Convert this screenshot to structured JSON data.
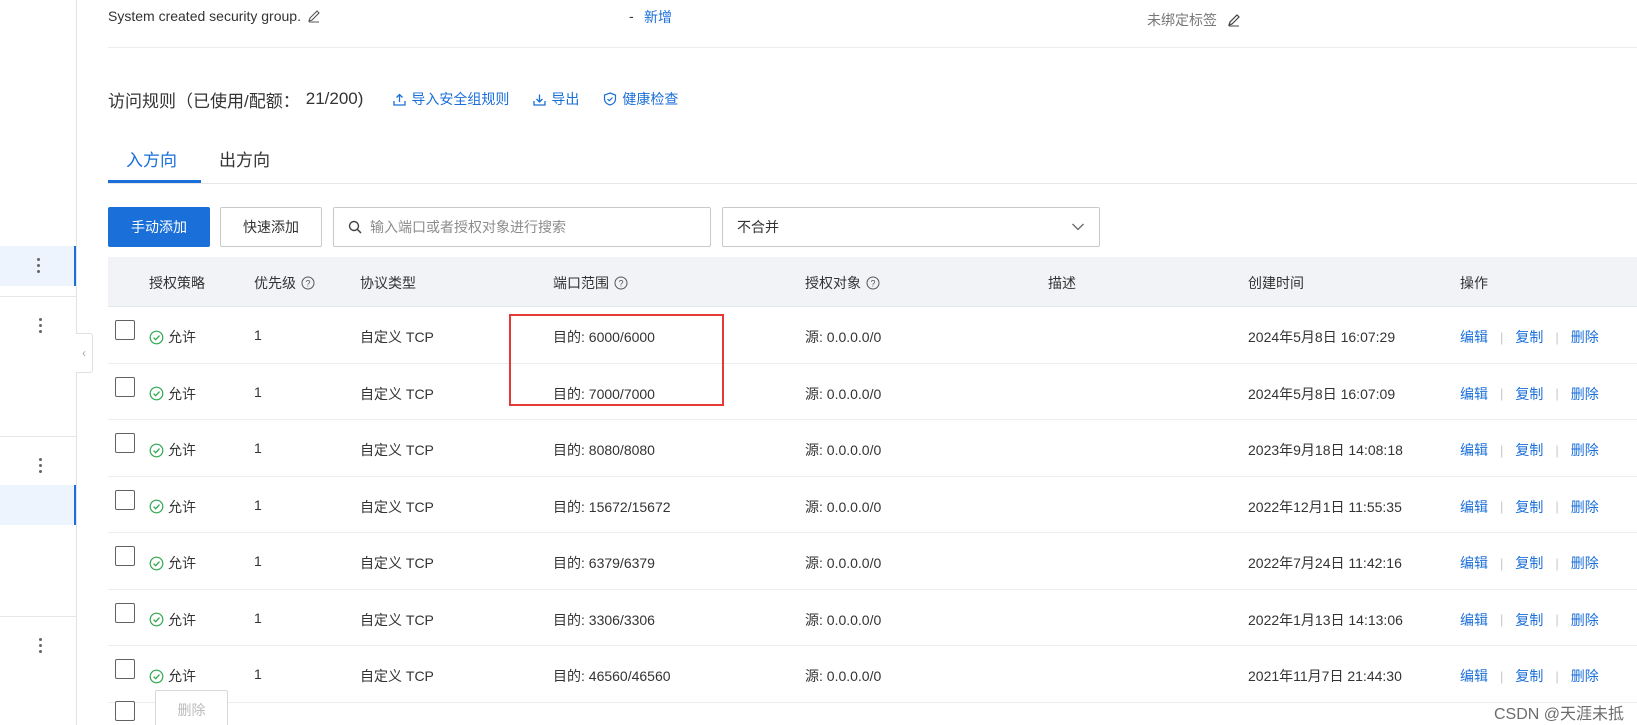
{
  "info": {
    "description": "System created security group.",
    "dash": "-",
    "add_label": "新增",
    "tag_label": "未绑定标签"
  },
  "section": {
    "title": "访问规则（已使用/配额：",
    "count": "21/200)",
    "import_label": "导入安全组规则",
    "export_label": "导出",
    "health_label": "健康检查"
  },
  "tabs": [
    {
      "label": "入方向",
      "active": true
    },
    {
      "label": "出方向",
      "active": false
    }
  ],
  "toolbar": {
    "manual_add": "手动添加",
    "quick_add": "快速添加",
    "search_placeholder": "输入端口或者授权对象进行搜索",
    "merge_select": "不合并"
  },
  "table": {
    "columns": [
      "授权策略",
      "优先级",
      "协议类型",
      "端口范围",
      "授权对象",
      "描述",
      "创建时间",
      "操作"
    ],
    "rows": [
      {
        "policy": "允许",
        "priority": "1",
        "protocol": "自定义 TCP",
        "port": "目的: 6000/6000",
        "source": "源: 0.0.0.0/0",
        "desc": "",
        "created": "2024年5月8日 16:07:29"
      },
      {
        "policy": "允许",
        "priority": "1",
        "protocol": "自定义 TCP",
        "port": "目的: 7000/7000",
        "source": "源: 0.0.0.0/0",
        "desc": "",
        "created": "2024年5月8日 16:07:09"
      },
      {
        "policy": "允许",
        "priority": "1",
        "protocol": "自定义 TCP",
        "port": "目的: 8080/8080",
        "source": "源: 0.0.0.0/0",
        "desc": "",
        "created": "2023年9月18日 14:08:18"
      },
      {
        "policy": "允许",
        "priority": "1",
        "protocol": "自定义 TCP",
        "port": "目的: 15672/15672",
        "source": "源: 0.0.0.0/0",
        "desc": "",
        "created": "2022年12月1日 11:55:35"
      },
      {
        "policy": "允许",
        "priority": "1",
        "protocol": "自定义 TCP",
        "port": "目的: 6379/6379",
        "source": "源: 0.0.0.0/0",
        "desc": "",
        "created": "2022年7月24日 11:42:16"
      },
      {
        "policy": "允许",
        "priority": "1",
        "protocol": "自定义 TCP",
        "port": "目的: 3306/3306",
        "source": "源: 0.0.0.0/0",
        "desc": "",
        "created": "2022年1月13日 14:13:06"
      },
      {
        "policy": "允许",
        "priority": "1",
        "protocol": "自定义 TCP",
        "port": "目的: 46560/46560",
        "source": "源: 0.0.0.0/0",
        "desc": "",
        "created": "2021年11月7日 21:44:30"
      }
    ],
    "ops": {
      "edit": "编辑",
      "copy": "复制",
      "delete": "删除"
    }
  },
  "footer": {
    "delete_label": "删除"
  },
  "watermark": "CSDN @天涯未抵",
  "colors": {
    "primary": "#1a6fd9",
    "success": "#2fa84f",
    "highlight": "#e53935",
    "header_bg": "#f1f3f7"
  }
}
